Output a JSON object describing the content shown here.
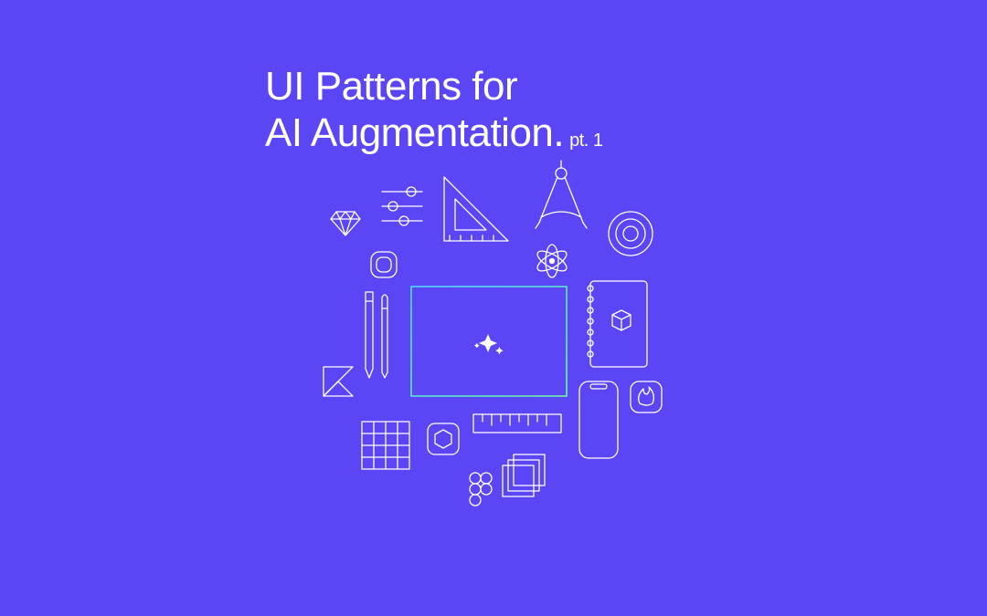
{
  "title": {
    "line1": "UI Patterns for",
    "line2": "AI Augmentation.",
    "suffix": "pt. 1"
  },
  "colors": {
    "background": "#5b46f6",
    "stroke": "#ffffff",
    "accent_gradient_start": "#4de0ff",
    "accent_gradient_end": "#6bff9e"
  },
  "icons": [
    "gem-icon",
    "sliders-icon",
    "set-square-icon",
    "compass-icon",
    "target-icon",
    "rounded-square-icon",
    "atom-icon",
    "pen-pencil-icon",
    "spiral-notebook-icon",
    "kotlin-icon",
    "canvas-rect-icon",
    "sparkle-icon",
    "cube-icon",
    "grid-icon",
    "hexagon-icon",
    "ruler-icon",
    "phone-icon",
    "firebase-icon",
    "figma-icon",
    "layers-icon"
  ]
}
